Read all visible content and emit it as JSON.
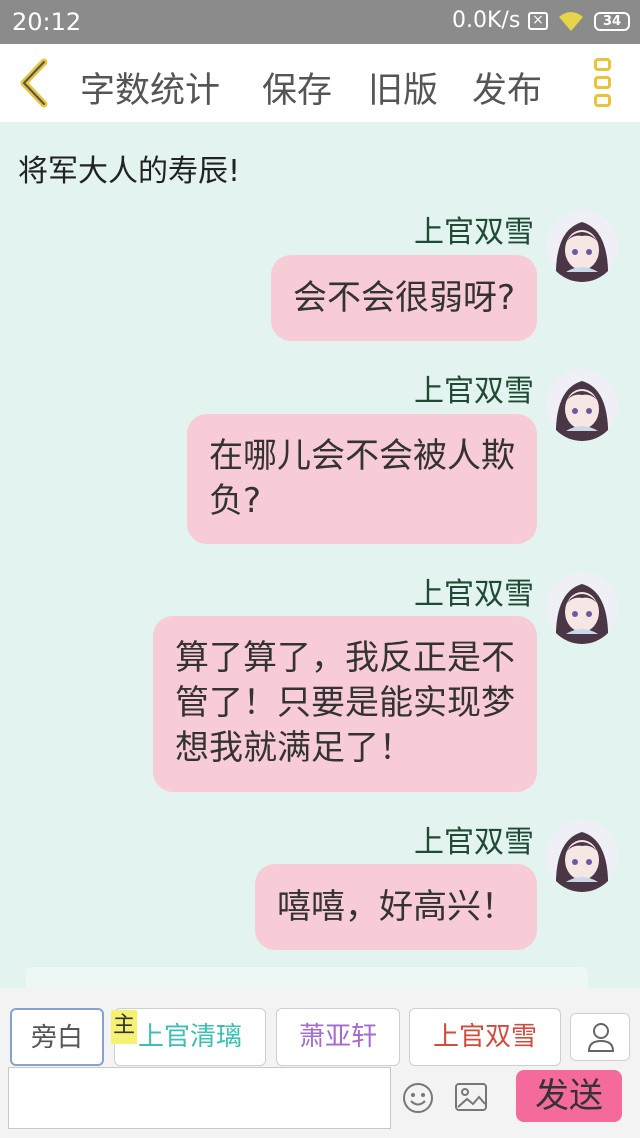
{
  "status_bar": {
    "time": "20:12",
    "net_speed": "0.0K/s",
    "battery": "34"
  },
  "toolbar": {
    "word_count": "字数统计",
    "save": "保存",
    "old_version": "旧版",
    "publish": "发布"
  },
  "story_title": "将军大人的寿辰!",
  "messages": [
    {
      "sender": "上官双雪",
      "lines": [
        "会不会很弱呀?"
      ]
    },
    {
      "sender": "上官双雪",
      "lines": [
        "在哪儿会不会被人欺",
        "负?"
      ]
    },
    {
      "sender": "上官双雪",
      "lines": [
        "算了算了，我反正是不",
        "管了！只要是能实现梦",
        "想我就满足了！"
      ]
    },
    {
      "sender": "上官双雪",
      "lines": [
        "嘻嘻，好高兴！"
      ]
    }
  ],
  "roles": {
    "narration": "旁白",
    "main_tag": "主",
    "role1": "上官清璃",
    "role2": "萧亚轩",
    "role3": "上官双雪"
  },
  "input": {
    "placeholder": ""
  },
  "send_label": "发送",
  "colors": {
    "bubble": "#f8ccd7",
    "background": "#e2f3f0",
    "send": "#f56a9c",
    "role1": "#3cc0b4",
    "role2": "#a56cd0",
    "role3": "#d24b3e",
    "accent": "#e7c43a"
  }
}
